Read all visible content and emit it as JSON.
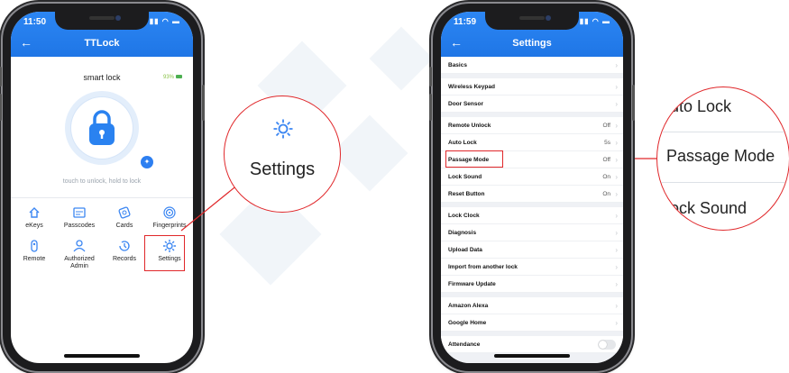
{
  "left_phone": {
    "status_time": "11:50",
    "title": "TTLock",
    "back_icon": "arrow-left-icon",
    "lock_name": "smart lock",
    "battery": "93%",
    "hint": "touch to unlock, hold to lock",
    "menu": [
      {
        "label": "eKeys",
        "icon": "ekey-icon"
      },
      {
        "label": "Passcodes",
        "icon": "passcode-icon"
      },
      {
        "label": "Cards",
        "icon": "card-icon"
      },
      {
        "label": "Fingerprints",
        "icon": "fingerprint-icon"
      },
      {
        "label": "Remote",
        "icon": "remote-icon"
      },
      {
        "label": "Authorized Admin",
        "icon": "admin-icon"
      },
      {
        "label": "Records",
        "icon": "records-icon"
      },
      {
        "label": "Settings",
        "icon": "gear-icon"
      }
    ]
  },
  "callout_left": {
    "label": "Settings",
    "icon": "gear-icon"
  },
  "right_phone": {
    "status_time": "11:59",
    "title": "Settings",
    "rows": [
      {
        "label": "Basics",
        "value": ""
      },
      {
        "label": "Wireless Keypad",
        "value": ""
      },
      {
        "label": "Door Sensor",
        "value": ""
      },
      {
        "label": "Remote Unlock",
        "value": "Off"
      },
      {
        "label": "Auto Lock",
        "value": "5s"
      },
      {
        "label": "Passage Mode",
        "value": "Off"
      },
      {
        "label": "Lock Sound",
        "value": "On"
      },
      {
        "label": "Reset Button",
        "value": "On"
      },
      {
        "label": "Lock Clock",
        "value": ""
      },
      {
        "label": "Diagnosis",
        "value": ""
      },
      {
        "label": "Upload Data",
        "value": ""
      },
      {
        "label": "Import from another lock",
        "value": ""
      },
      {
        "label": "Firmware Update",
        "value": ""
      },
      {
        "label": "Amazon Alexa",
        "value": ""
      },
      {
        "label": "Google Home",
        "value": ""
      },
      {
        "label": "Attendance",
        "value": ""
      }
    ]
  },
  "callout_right": {
    "top": "uto Lock",
    "middle": "Passage Mode",
    "bottom": "ock Sound"
  },
  "colors": {
    "accent": "#2a82f0",
    "highlight": "#e0272a"
  }
}
